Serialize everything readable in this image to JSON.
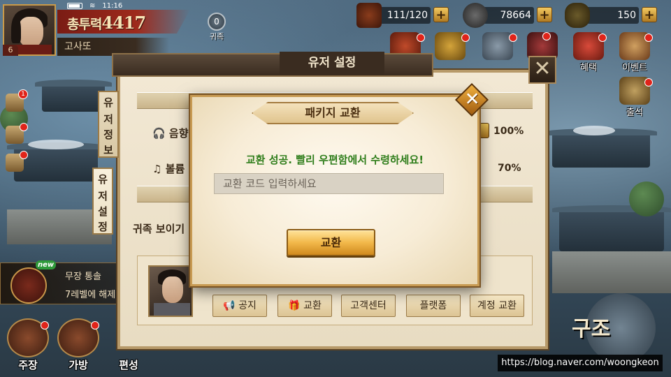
{
  "status": {
    "time": "11:16"
  },
  "player": {
    "power_label": "총투력",
    "power_value": "4417",
    "name": "고사또",
    "level": "6"
  },
  "noble": {
    "count": "0",
    "label": "귀족"
  },
  "resources": [
    {
      "icon": "stamina-icon",
      "value": "111/120"
    },
    {
      "icon": "silver-coin-icon",
      "value": "78664"
    },
    {
      "icon": "gold-ingot-icon",
      "value": "150"
    }
  ],
  "top_icons": [
    {
      "icon": "gift-bag-icon",
      "label": ""
    },
    {
      "icon": "dragon-icon",
      "label": ""
    },
    {
      "icon": "treasure-icon",
      "label": ""
    },
    {
      "icon": "helmet-icon",
      "label": ""
    },
    {
      "icon": "chest-icon",
      "label": "혜택"
    },
    {
      "icon": "event-icon",
      "label": "이벤트"
    },
    {
      "icon": "attendance-icon",
      "label": "출석"
    }
  ],
  "side": {
    "badge_count": "1"
  },
  "quest": {
    "new_tag": "new",
    "title": "무장 통솔",
    "desc": "7레벨에 해제"
  },
  "bottom_nav": [
    {
      "label": "주장"
    },
    {
      "label": "가방"
    },
    {
      "label": "편성"
    }
  ],
  "settings_panel": {
    "title": "유저 설정",
    "close": "✕",
    "tabs": [
      {
        "label": [
          "유",
          "저",
          "정",
          "보"
        ]
      },
      {
        "label": [
          "유",
          "저",
          "설",
          "정"
        ]
      }
    ],
    "rows": [
      {
        "label": "음향",
        "value": "100%"
      },
      {
        "label": "볼륨",
        "value": "70%"
      }
    ],
    "noble_label": "귀족 보이기",
    "buttons": [
      {
        "label": "공지",
        "icon": "megaphone-icon"
      },
      {
        "label": "교환",
        "icon": "gift-icon"
      },
      {
        "label": "고객센터"
      },
      {
        "label": "플랫폼"
      },
      {
        "label": "계정 교환"
      }
    ]
  },
  "exchange_modal": {
    "title": "패키지 교환",
    "message": "교환 성공. 빨리 우편함에서 수령하세요!",
    "input_placeholder": "교환 코드 입력하세요",
    "input_value": "",
    "submit_label": "교환",
    "close": "✕"
  },
  "right_badge": "구조",
  "watermark": "https://blog.naver.com/woongkeon"
}
